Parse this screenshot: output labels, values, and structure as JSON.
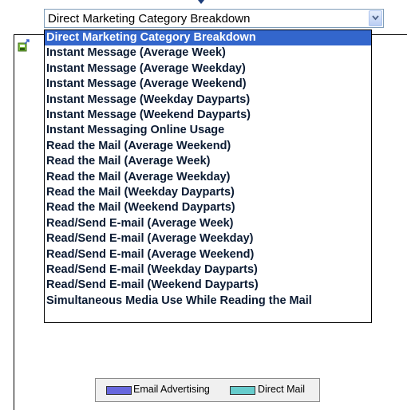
{
  "select": {
    "value": "Direct Marketing Category Breakdown"
  },
  "dropdown": {
    "options": [
      "Direct Marketing Category Breakdown",
      "Instant Message (Average Week)",
      "Instant Message (Average Weekday)",
      "Instant Message (Average Weekend)",
      "Instant Message (Weekday Dayparts)",
      "Instant Message (Weekend Dayparts)",
      "Instant Messaging Online Usage",
      "Read the Mail (Average Weekend)",
      "Read the Mail (Average Week)",
      "Read the Mail (Average Weekday)",
      "Read the Mail (Weekday Dayparts)",
      "Read the Mail (Weekend Dayparts)",
      "Read/Send E-mail (Average Week)",
      "Read/Send E-mail (Average Weekday)",
      "Read/Send E-mail (Average Weekend)",
      "Read/Send E-mail (Weekday Dayparts)",
      "Read/Send E-mail (Weekend Dayparts)",
      "Simultaneous Media Use While Reading the Mail"
    ],
    "selected_index": 0,
    "highlight_color": "#3366cc"
  },
  "legend": {
    "items": [
      {
        "label": "Email Advertising",
        "color": "#6666dd"
      },
      {
        "label": "Direct Mail",
        "color": "#66cccc"
      }
    ]
  },
  "icons": {
    "panel_icon": "export-icon",
    "select_arrow": "chevron-down-icon"
  }
}
